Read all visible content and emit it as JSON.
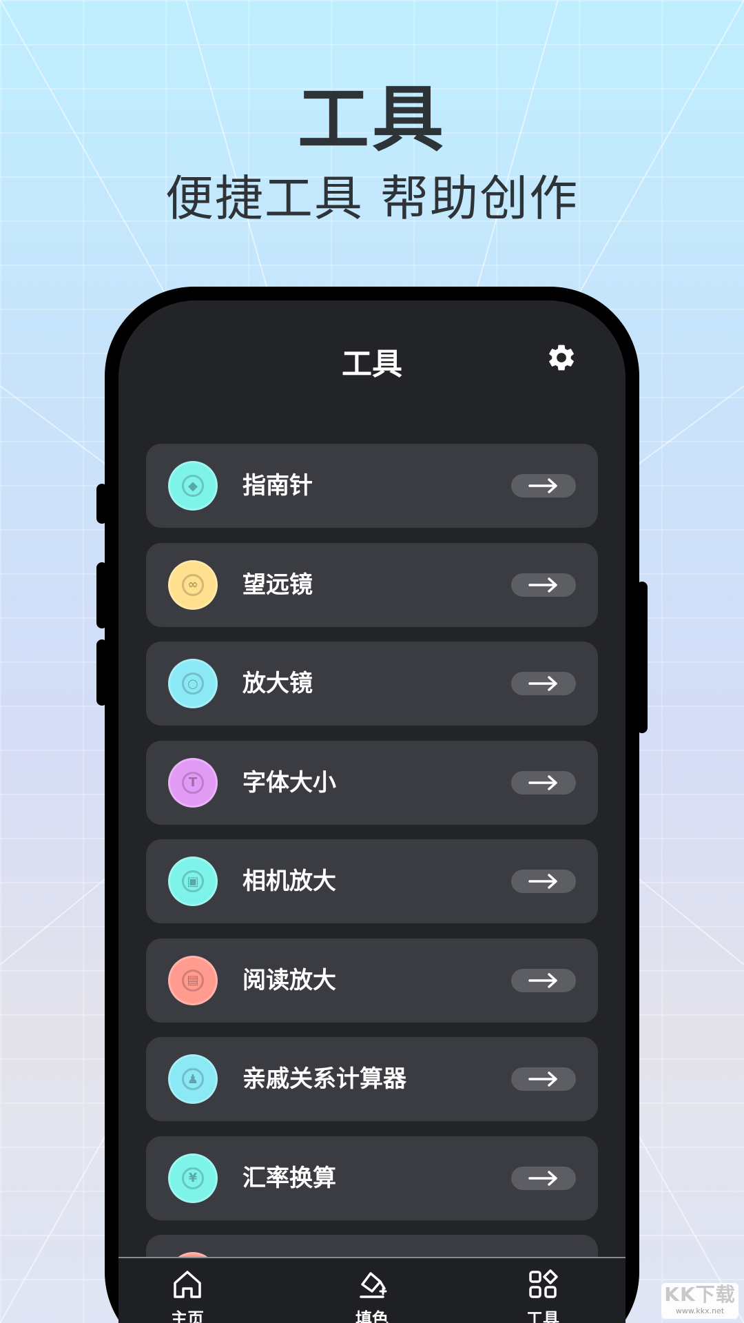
{
  "hero": {
    "title": "工具",
    "subtitle": "便捷工具 帮助创作"
  },
  "app": {
    "title": "工具",
    "settings_icon": "gear-icon"
  },
  "tools": [
    {
      "label": "指南针",
      "icon": "compass-icon",
      "color": "#7ef3ea"
    },
    {
      "label": "望远镜",
      "icon": "binoculars-icon",
      "color": "#ffe08e"
    },
    {
      "label": "放大镜",
      "icon": "magnifier-icon",
      "color": "#8ae9f4"
    },
    {
      "label": "字体大小",
      "icon": "font-size-icon",
      "color": "#e29bf5"
    },
    {
      "label": "相机放大",
      "icon": "camera-icon",
      "color": "#7ef3ea"
    },
    {
      "label": "阅读放大",
      "icon": "book-icon",
      "color": "#ff9b8f"
    },
    {
      "label": "亲戚关系计算器",
      "icon": "family-icon",
      "color": "#8ae9f4"
    },
    {
      "label": "汇率换算",
      "icon": "currency-icon",
      "color": "#7ef3ea"
    },
    {
      "label": "",
      "icon": "partial-icon",
      "color": "#ff9b8f"
    }
  ],
  "tabbar": {
    "home": "主页",
    "fill": "填色",
    "tools": "工具"
  },
  "watermark": {
    "main": "KK下载",
    "url": "www.kkx.net"
  }
}
